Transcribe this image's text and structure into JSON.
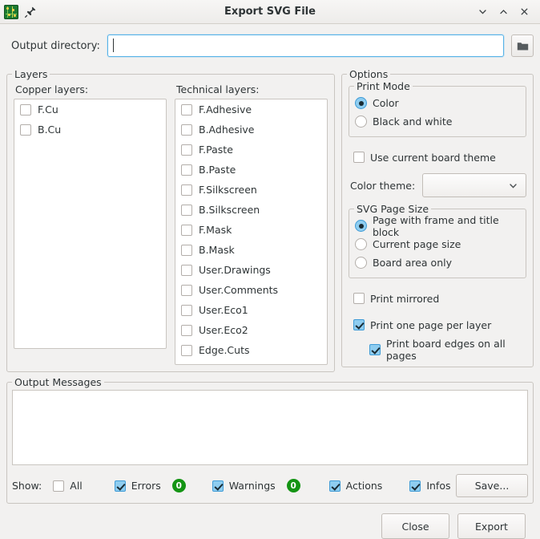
{
  "window": {
    "title": "Export SVG File",
    "app_icon": "pcb-board-icon",
    "pin_icon": "pin-icon",
    "minimize_icon": "chevron-down-icon",
    "maximize_icon": "chevron-up-icon",
    "close_icon": "close-icon"
  },
  "output_directory": {
    "label": "Output directory:",
    "value": "",
    "placeholder": "",
    "browse_icon": "folder-icon"
  },
  "layers": {
    "legend": "Layers",
    "copper": {
      "label": "Copper layers:",
      "items": [
        {
          "label": "F.Cu",
          "checked": false
        },
        {
          "label": "B.Cu",
          "checked": false
        }
      ]
    },
    "technical": {
      "label": "Technical layers:",
      "items": [
        {
          "label": "F.Adhesive",
          "checked": false
        },
        {
          "label": "B.Adhesive",
          "checked": false
        },
        {
          "label": "F.Paste",
          "checked": false
        },
        {
          "label": "B.Paste",
          "checked": false
        },
        {
          "label": "F.Silkscreen",
          "checked": false
        },
        {
          "label": "B.Silkscreen",
          "checked": false
        },
        {
          "label": "F.Mask",
          "checked": false
        },
        {
          "label": "B.Mask",
          "checked": false
        },
        {
          "label": "User.Drawings",
          "checked": false
        },
        {
          "label": "User.Comments",
          "checked": false
        },
        {
          "label": "User.Eco1",
          "checked": false
        },
        {
          "label": "User.Eco2",
          "checked": false
        },
        {
          "label": "Edge.Cuts",
          "checked": false
        }
      ]
    }
  },
  "options": {
    "legend": "Options",
    "print_mode": {
      "legend": "Print Mode",
      "items": [
        {
          "label": "Color",
          "selected": true
        },
        {
          "label": "Black and white",
          "selected": false
        }
      ]
    },
    "use_board_theme": {
      "label": "Use current board theme",
      "checked": false
    },
    "color_theme": {
      "label": "Color theme:",
      "value": "",
      "chevron_icon": "chevron-down-icon"
    },
    "page_size": {
      "legend": "SVG Page Size",
      "items": [
        {
          "label": "Page with frame and title block",
          "selected": true
        },
        {
          "label": "Current page size",
          "selected": false
        },
        {
          "label": "Board area only",
          "selected": false
        }
      ]
    },
    "print_mirrored": {
      "label": "Print mirrored",
      "checked": false
    },
    "one_page_per_layer": {
      "label": "Print one page per layer",
      "checked": true
    },
    "board_edges_all_pages": {
      "label": "Print board edges on all pages",
      "checked": true
    }
  },
  "output_messages": {
    "legend": "Output Messages",
    "content": "",
    "show_label": "Show:",
    "filters": [
      {
        "label": "All",
        "checked": false,
        "badge": null
      },
      {
        "label": "Errors",
        "checked": true,
        "badge": "0"
      },
      {
        "label": "Warnings",
        "checked": true,
        "badge": "0"
      },
      {
        "label": "Actions",
        "checked": true,
        "badge": null
      },
      {
        "label": "Infos",
        "checked": true,
        "badge": null
      }
    ],
    "save_label": "Save..."
  },
  "footer": {
    "close_label": "Close",
    "export_label": "Export"
  },
  "colors": {
    "accent": "#56b3e8",
    "check_fill": "#8ecdf0",
    "badge_green": "#149414",
    "window_bg": "#f2f1f0"
  }
}
